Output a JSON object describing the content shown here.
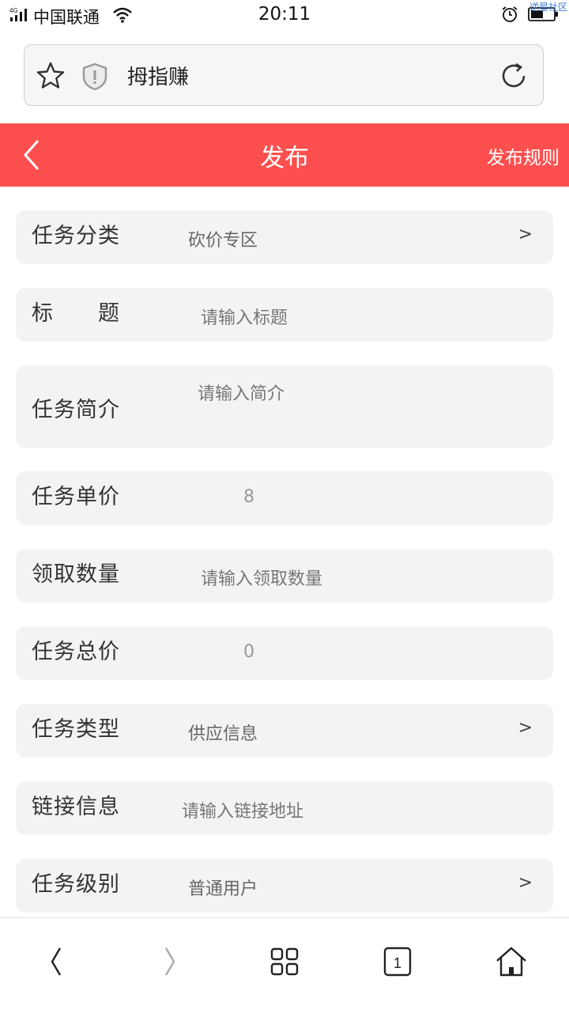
{
  "statusbar": {
    "network": "4G",
    "carrier": "中国联通",
    "time": "20:11",
    "watermark": "逆星社区",
    "icons": [
      "signal-icon",
      "wifi-icon",
      "alarm-icon",
      "battery-icon"
    ]
  },
  "browser": {
    "url_text": "拇指赚",
    "icons": [
      "star-icon",
      "shield-icon",
      "refresh-icon"
    ]
  },
  "header": {
    "title": "发布",
    "rules_link": "发布规则",
    "back_icon": "chevron-left-icon",
    "background": "#fd4f4f"
  },
  "form": {
    "category": {
      "label": "任务分类",
      "value": "砍价专区",
      "arrow": ">"
    },
    "title": {
      "label": "标　　题",
      "placeholder": "请输入标题"
    },
    "intro": {
      "label": "任务简介",
      "placeholder": "请输入简介"
    },
    "unit_price": {
      "label": "任务单价",
      "value": "8"
    },
    "quantity": {
      "label": "领取数量",
      "placeholder": "请输入领取数量"
    },
    "total_price": {
      "label": "任务总价",
      "value": "0"
    },
    "type": {
      "label": "任务类型",
      "value": "供应信息",
      "arrow": ">"
    },
    "link": {
      "label": "链接信息",
      "placeholder": "请输入链接地址"
    },
    "level": {
      "label": "任务级别",
      "value": "普通用户",
      "arrow": ">"
    }
  },
  "bottom_nav": {
    "tab_count": "1",
    "icons": [
      "back-arrow-icon",
      "forward-arrow-icon",
      "grid-menu-icon",
      "tabs-icon",
      "home-icon"
    ]
  }
}
